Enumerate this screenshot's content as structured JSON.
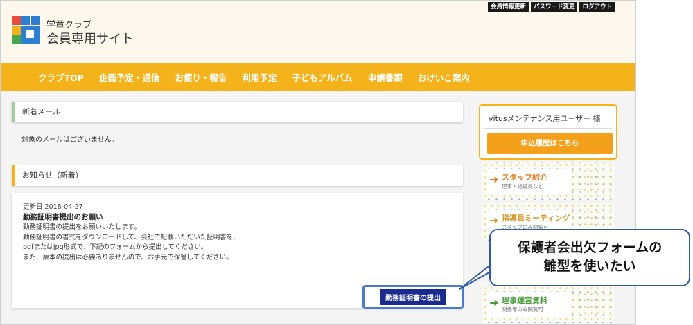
{
  "header": {
    "brand_small": "学童クラブ",
    "brand_large": "会員専用サイト",
    "utility_links": [
      "会員情報更新",
      "パスワード変更",
      "ログアウト"
    ]
  },
  "nav": [
    "クラブTOP",
    "企画予定・通信",
    "お便り・報告",
    "利用予定",
    "子どもアルバム",
    "申請書類",
    "おけいこ案内"
  ],
  "mail_section": {
    "heading": "新着メール",
    "empty_message": "対象のメールはございません。"
  },
  "news_section": {
    "heading": "お知らせ（新着）",
    "date": "更新日 2018-04-27",
    "title": "勤務証明書提出のお願い",
    "body_lines": [
      "勤務証明書の提出をお願いいたします。",
      "勤務証明書の書式をダウンロードして、会社で記載いただいた証明書を、",
      "pdfまたはjpg形式で、下記のフォームから提出してください。",
      "また、原本の提出は必要ありませんので、お手元で保管してください。"
    ],
    "submit_button": "勤務証明書の提出"
  },
  "sidebar": {
    "user_name": "vitusメンテナンス用ユーザー 様",
    "history_button": "申込履歴はこちら",
    "banners": [
      {
        "title": "スタッフ紹介",
        "sub": "理事・指導員など",
        "color": "#e07a1a"
      },
      {
        "title": "指導員ミーティング",
        "sub": "スタッフのみ閲覧可",
        "color": "#d49a2a"
      },
      {
        "title": "理事運営資料",
        "sub": "関係者のみ閲覧可",
        "color": "#4a9a3a"
      }
    ]
  },
  "callout": {
    "line1": "保護者会出欠フォームの",
    "line2": "雛型を使いたい"
  },
  "colors": {
    "accent": "#f4b21b",
    "nav_text": "#ffffff",
    "mail_bar": "#9dd098",
    "submit_bg": "#1b2a8f",
    "callout_border": "#2e5aa6"
  }
}
